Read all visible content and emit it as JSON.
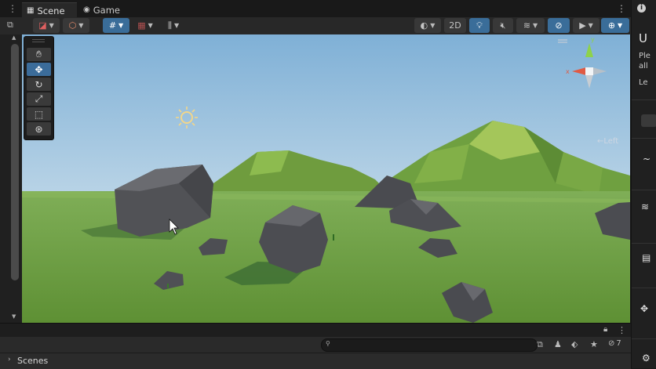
{
  "tabs": [
    {
      "label": "Scene",
      "icon": "scene-grid-icon",
      "active": true
    },
    {
      "label": "Game",
      "icon": "game-controller-icon",
      "active": false
    }
  ],
  "toolbar": {
    "twod_label": "2D"
  },
  "gizmo": {
    "view_label": "←Left"
  },
  "hierarchy": {
    "scenes_label": "Scenes",
    "hidden_count": "7"
  },
  "inspector_fragment": {
    "title": "U",
    "line1": "Ple",
    "line2": "all",
    "line3": "Le"
  },
  "colors": {
    "accent": "#3a6d99",
    "sky_top": "#88b4d6",
    "ground": "#6a9a46"
  },
  "icons": [
    "hand-icon",
    "move-icon",
    "rotate-icon",
    "scale-icon",
    "rect-tool-icon",
    "transform-icon",
    "sun-icon",
    "search-icon",
    "lock-icon",
    "kebab-menu-icon"
  ]
}
